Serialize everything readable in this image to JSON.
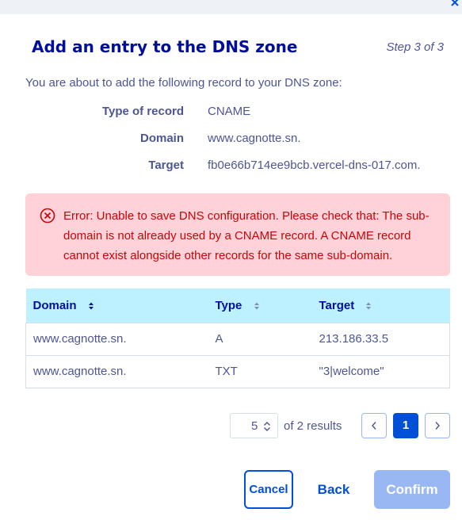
{
  "dialog": {
    "title": "Add an entry to the DNS zone",
    "step": "Step 3 of 3",
    "intro": "You are about to add the following record to your DNS zone:",
    "record": {
      "type_label": "Type of record",
      "type_value": "CNAME",
      "domain_label": "Domain",
      "domain_value": "www.cagnotte.sn.",
      "target_label": "Target",
      "target_value": "fb0e66b714ee9bcb.vercel-dns-017.com."
    },
    "error": {
      "message": "Error: Unable to save DNS configuration. Please check that: The sub-domain is not already used by a CNAME record. A CNAME record cannot exist alongside other records for the same sub-domain."
    }
  },
  "table": {
    "headers": [
      "Domain",
      "Type",
      "Target"
    ],
    "rows": [
      [
        "www.cagnotte.sn.",
        "A",
        "213.186.33.5"
      ],
      [
        "www.cagnotte.sn.",
        "TXT",
        "\"3|welcome\""
      ]
    ]
  },
  "pagination": {
    "page_size": "5",
    "results_text": "of 2 results",
    "current_page": "1"
  },
  "buttons": {
    "cancel": "Cancel",
    "back": "Back",
    "confirm": "Confirm"
  },
  "colors": {
    "title": "#000e9c",
    "primary": "#0050d7",
    "error_bg": "#ffd1d9",
    "error_text": "#c30808",
    "table_header_bg": "#bef1ff",
    "confirm_disabled": "#99b7f2"
  }
}
